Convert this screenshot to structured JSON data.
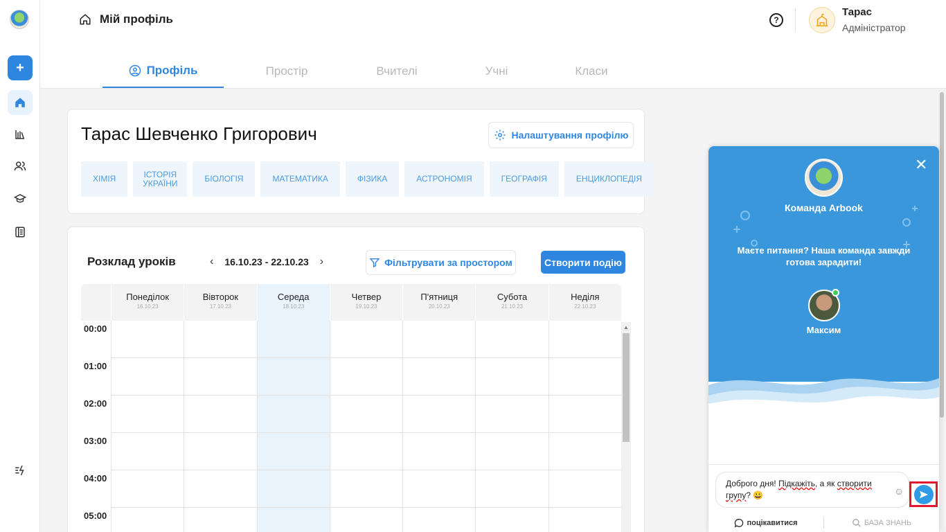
{
  "header": {
    "title": "Мій профіль",
    "help_glyph": "?",
    "user_name": "Тарас",
    "user_role": "Адміністратор"
  },
  "tabs": [
    {
      "label": "Профіль",
      "active": true
    },
    {
      "label": "Простір"
    },
    {
      "label": "Вчителі"
    },
    {
      "label": "Учні"
    },
    {
      "label": "Класи"
    }
  ],
  "profile": {
    "full_name": "Тарас Шевченко Григорович",
    "settings_label": "Налаштування профілю",
    "subjects": [
      "ХІМІЯ",
      "ІСТОРІЯ УКРАЇНИ",
      "БІОЛОГІЯ",
      "МАТЕМАТИКА",
      "ФІЗИКА",
      "АСТРОНОМІЯ",
      "ГЕОГРАФІЯ",
      "ЕНЦИКЛОПЕДІЯ"
    ]
  },
  "schedule": {
    "title": "Розклад уроків",
    "range": "16.10.23 - 22.10.23",
    "prev": "‹",
    "next": "›",
    "filter_label": "Фільтрувати за простором",
    "create_label": "Створити подію",
    "days": [
      {
        "name": "Понеділок",
        "date": "16.10.23"
      },
      {
        "name": "Вівторок",
        "date": "17.10.23"
      },
      {
        "name": "Середа",
        "date": "18.10.23",
        "today": true
      },
      {
        "name": "Четвер",
        "date": "19.10.23"
      },
      {
        "name": "П'ятниця",
        "date": "20.10.23"
      },
      {
        "name": "Субота",
        "date": "21.10.23"
      },
      {
        "name": "Неділя",
        "date": "22.10.23"
      }
    ],
    "hours": [
      "00:00",
      "01:00",
      "02:00",
      "03:00",
      "04:00",
      "05:00"
    ]
  },
  "chat": {
    "team_name": "Команда Arbook",
    "question": "Маєте питання? Наша команда завжди готова зарадити!",
    "agent_name": "Максим",
    "message_parts": [
      "Доброго дня! ",
      "Підкажіть",
      ", а як ",
      "створити",
      " ",
      "групу",
      "? 😀"
    ],
    "footer_chat": "поцікавитися",
    "footer_kb": "БАЗА ЗНАНЬ",
    "colors": {
      "accent": "#2f86e0",
      "chat_bg": "#3b97dc",
      "highlight": "#e0182d"
    }
  }
}
